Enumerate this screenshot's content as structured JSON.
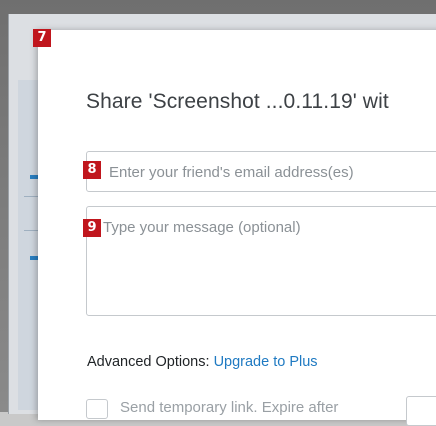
{
  "dialog": {
    "title": "Share 'Screenshot ...0.11.19' wit",
    "email_placeholder": "Enter your friend's email address(es)",
    "message_placeholder": "Type your message (optional)",
    "advanced_label": "Advanced Options:",
    "upgrade_link": "Upgrade to Plus",
    "temp_link_label": "Send temporary link. Expire after"
  },
  "markers": {
    "dialog": "7",
    "email": "8",
    "message": "9"
  },
  "colors": {
    "marker": "#c0161d",
    "link": "#1f7ac2"
  }
}
